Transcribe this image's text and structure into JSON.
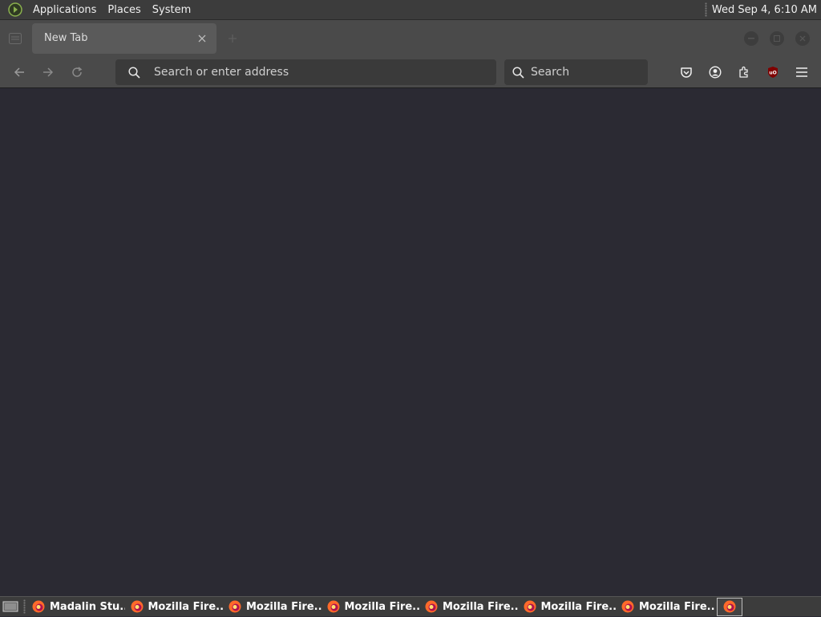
{
  "top_panel": {
    "menus": [
      "Applications",
      "Places",
      "System"
    ],
    "clock": "Wed Sep  4,  6:10 AM"
  },
  "browser": {
    "tab": {
      "title": "New Tab"
    },
    "url_bar": {
      "placeholder": "Search or enter address",
      "value": ""
    },
    "search_bar": {
      "placeholder": "Search",
      "value": ""
    },
    "toolbar_icons": [
      "pocket-icon",
      "account-icon",
      "extensions-icon",
      "ublock-origin-icon",
      "menu-icon"
    ],
    "ublock_label": "uO"
  },
  "taskbar": {
    "items": [
      {
        "label": "Madalin Stu..."
      },
      {
        "label": "Mozilla Fire..."
      },
      {
        "label": "Mozilla Fire..."
      },
      {
        "label": "Mozilla Fire..."
      },
      {
        "label": "Mozilla Fire..."
      },
      {
        "label": "Mozilla Fire..."
      },
      {
        "label": "Mozilla Fire..."
      }
    ]
  },
  "colors": {
    "panel_bg": "#3c3c3c",
    "toolbar_bg": "#4a4a4a",
    "content_bg": "#2b2a33",
    "ublock_red": "#800000",
    "menu_logo_green": "#8ab04e"
  }
}
